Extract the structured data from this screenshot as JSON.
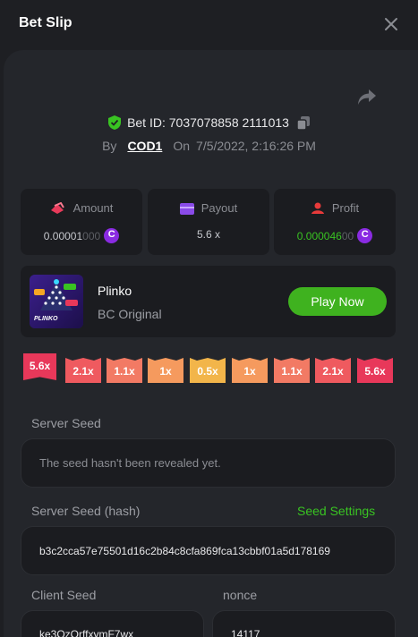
{
  "header": {
    "title": "Bet Slip",
    "close_icon": "close-icon"
  },
  "bet": {
    "id_prefix": "Bet ID:",
    "id": "7037078858 2111013",
    "by_label": "By",
    "user": "COD1",
    "on_label": "On",
    "date": "7/5/2022, 2:16:26 PM",
    "verified_color": "#39c322"
  },
  "stats": {
    "amount": {
      "label": "Amount",
      "value_main": "0.00001",
      "value_dim": "000",
      "coin": "C"
    },
    "payout": {
      "label": "Payout",
      "value": "5.6 x"
    },
    "profit": {
      "label": "Profit",
      "value_main": "0.000046",
      "value_dim": "00",
      "coin": "C"
    }
  },
  "game": {
    "name": "Plinko",
    "provider": "BC Original",
    "play_label": "Play Now",
    "thumb_label": "PLINKO"
  },
  "multipliers": [
    {
      "label": "5.6x",
      "color": "#e8385a",
      "active": true
    },
    {
      "label": "2.1x",
      "color": "#ef5a5f",
      "active": false
    },
    {
      "label": "1.1x",
      "color": "#f27a64",
      "active": false
    },
    {
      "label": "1x",
      "color": "#f59a5e",
      "active": false
    },
    {
      "label": "0.5x",
      "color": "#f2b54a",
      "active": false
    },
    {
      "label": "1x",
      "color": "#f59a5e",
      "active": false
    },
    {
      "label": "1.1x",
      "color": "#f27a64",
      "active": false
    },
    {
      "label": "2.1x",
      "color": "#ef5a5f",
      "active": false
    },
    {
      "label": "5.6x",
      "color": "#e8385a",
      "active": false
    }
  ],
  "seeds": {
    "server_seed_label": "Server Seed",
    "server_seed_value": "The seed hasn't been revealed yet.",
    "server_hash_label": "Server Seed (hash)",
    "seed_settings_label": "Seed Settings",
    "server_hash_value": "b3c2cca57e75501d16c2b84c8cfa869fca13cbbf01a5d178169",
    "client_seed_label": "Client Seed",
    "client_seed_value": "ke3OzOrffxymF7wx",
    "nonce_label": "nonce",
    "nonce_value": "14117"
  }
}
